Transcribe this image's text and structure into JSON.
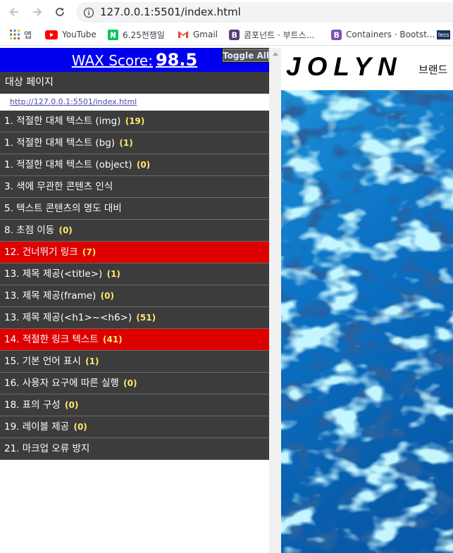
{
  "browser": {
    "url": "127.0.0.1:5501/index.html",
    "bookmarks": [
      {
        "icon": "apps-grid-icon",
        "label": "앱"
      },
      {
        "icon": "youtube-icon",
        "label": "YouTube"
      },
      {
        "icon": "naver-icon",
        "label": "6.25전쟁일"
      },
      {
        "icon": "gmail-icon",
        "label": "Gmail"
      },
      {
        "icon": "bootstrap-icon",
        "label": "콤포넌트 · 부트스..."
      },
      {
        "icon": "bootstrap-icon",
        "label": "Containers · Bootst..."
      },
      {
        "icon": "less-icon",
        "label": "less"
      }
    ]
  },
  "wax": {
    "score_label": "WAX Score:",
    "score_value": "98.5",
    "toggle_label": "Toggle All",
    "target_label": "대상 페이지",
    "target_url": "http://127.0.0.1:5501/index.html",
    "items": [
      {
        "label": "1. 적절한 대체 텍스트 (img)",
        "count": "(19)",
        "alert": false
      },
      {
        "label": "1. 적절한 대체 텍스트 (bg)",
        "count": "(1)",
        "alert": false
      },
      {
        "label": "1. 적절한 대체 텍스트 (object)",
        "count": "(0)",
        "alert": false
      },
      {
        "label": "3. 색에 무관한 콘텐츠 인식",
        "count": "",
        "alert": false
      },
      {
        "label": "5. 텍스트 콘텐츠의 명도 대비",
        "count": "",
        "alert": false
      },
      {
        "label": "8. 초점 이동",
        "count": "(0)",
        "alert": false
      },
      {
        "label": "12. 건너뛰기 링크",
        "count": "(7)",
        "alert": true
      },
      {
        "label": "13. 제목 제공(<title>)",
        "count": "(1)",
        "alert": false
      },
      {
        "label": "13. 제목 제공(frame)",
        "count": "(0)",
        "alert": false
      },
      {
        "label": "13. 제목 제공(<h1>~<h6>)",
        "count": "(51)",
        "alert": false
      },
      {
        "label": "14. 적절한 링크 텍스트",
        "count": "(41)",
        "alert": true
      },
      {
        "label": "15. 기본 언어 표시",
        "count": "(1)",
        "alert": false
      },
      {
        "label": "16. 사용자 요구에 따른 실행",
        "count": "(0)",
        "alert": false
      },
      {
        "label": "18. 표의 구성",
        "count": "(0)",
        "alert": false
      },
      {
        "label": "19. 레이블 제공",
        "count": "(0)",
        "alert": false
      },
      {
        "label": "21. 마크업 오류 방지",
        "count": "",
        "alert": false
      }
    ]
  },
  "preview": {
    "brand": "JOLYN",
    "nav_label": "브랜드"
  },
  "colors": {
    "wax_header": "#0000ee",
    "item_bg": "#3c3c3c",
    "alert_bg": "#dd0000",
    "count_color": "#ffe96a"
  }
}
